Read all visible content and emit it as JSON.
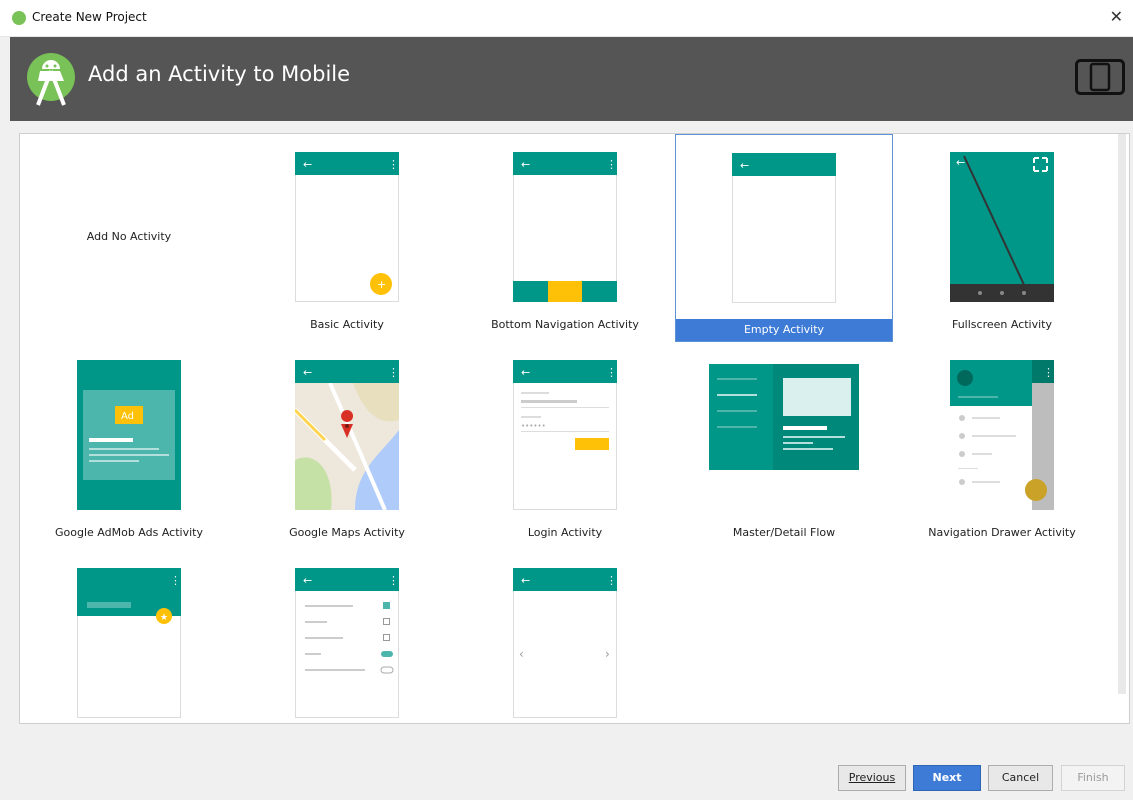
{
  "window": {
    "title": "Create New Project",
    "close_glyph": "✕"
  },
  "header": {
    "title": "Add an Activity to Mobile"
  },
  "templates": [
    {
      "label": "Add No Activity",
      "selected": false
    },
    {
      "label": "Basic Activity",
      "selected": false
    },
    {
      "label": "Bottom Navigation Activity",
      "selected": false
    },
    {
      "label": "Empty Activity",
      "selected": true
    },
    {
      "label": "Fullscreen Activity",
      "selected": false
    },
    {
      "label": "Google AdMob Ads Activity",
      "selected": false
    },
    {
      "label": "Google Maps Activity",
      "selected": false
    },
    {
      "label": "Login Activity",
      "selected": false
    },
    {
      "label": "Master/Detail Flow",
      "selected": false
    },
    {
      "label": "Navigation Drawer Activity",
      "selected": false
    },
    {
      "label": "",
      "selected": false
    },
    {
      "label": "",
      "selected": false
    },
    {
      "label": "",
      "selected": false
    }
  ],
  "thumb_text": {
    "ad": "Ad"
  },
  "buttons": {
    "previous": "Previous",
    "next": "Next",
    "cancel": "Cancel",
    "finish": "Finish"
  },
  "colors": {
    "teal": "#009688",
    "amber": "#ffc107",
    "selection": "#3d7bd6",
    "header": "#555555"
  }
}
